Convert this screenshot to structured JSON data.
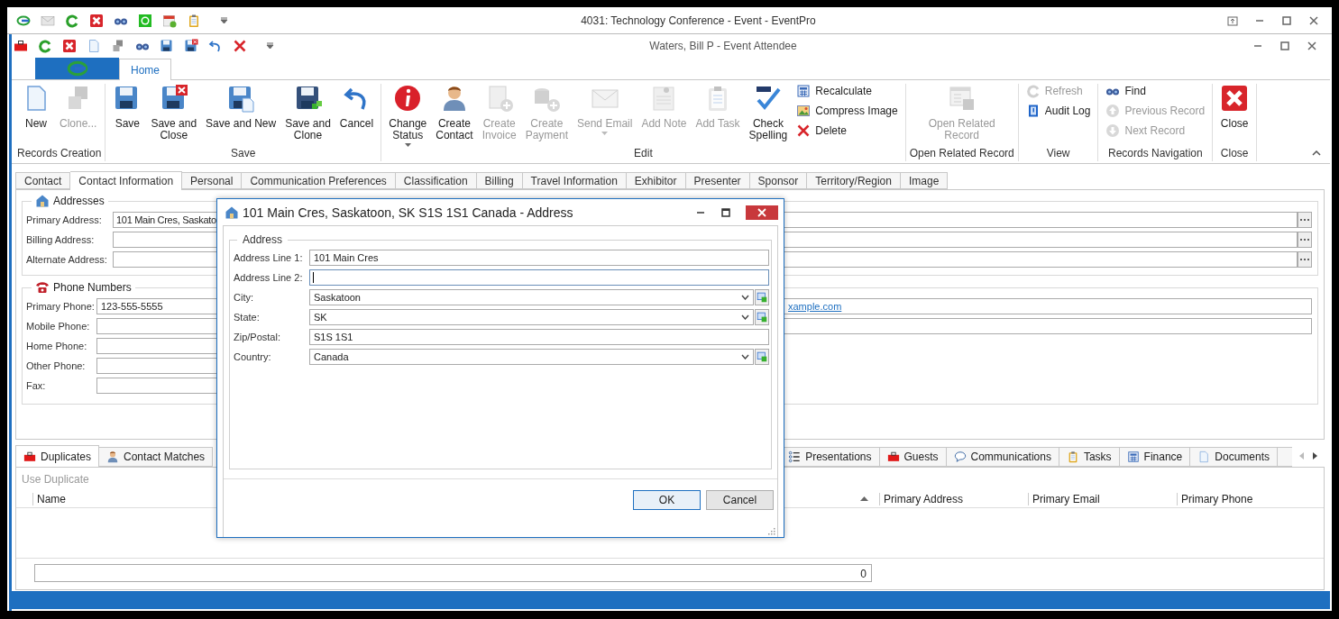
{
  "window": {
    "title": "4031: Technology Conference - Event - EventPro"
  },
  "document_window": {
    "title": "Waters, Bill P - Event Attendee"
  },
  "ribbon": {
    "tabs": [
      {
        "label": "Home",
        "selected": true
      }
    ],
    "groups": [
      {
        "label": "Records Creation",
        "buttons": [
          {
            "label": "New",
            "kind": "large",
            "disabled": false
          },
          {
            "label": "Clone...",
            "kind": "large",
            "disabled": true
          }
        ]
      },
      {
        "label": "Save",
        "buttons": [
          {
            "label": "Save",
            "kind": "large",
            "disabled": false
          },
          {
            "label": "Save and\nClose",
            "kind": "large",
            "disabled": false
          },
          {
            "label": "Save and New",
            "kind": "large",
            "disabled": false
          },
          {
            "label": "Save and\nClone",
            "kind": "large",
            "disabled": false
          },
          {
            "label": "Cancel",
            "kind": "large",
            "disabled": false
          }
        ]
      },
      {
        "label": "Edit",
        "buttons": [
          {
            "label": "Change\nStatus",
            "kind": "large",
            "disabled": false,
            "dropdown": true
          },
          {
            "label": "Create\nContact",
            "kind": "large",
            "disabled": false
          },
          {
            "label": "Create\nInvoice",
            "kind": "large",
            "disabled": true
          },
          {
            "label": "Create\nPayment",
            "kind": "large",
            "disabled": true
          },
          {
            "label": "Send Email",
            "kind": "large",
            "disabled": true,
            "dropdown": true
          },
          {
            "label": "Add Note",
            "kind": "large",
            "disabled": true
          },
          {
            "label": "Add Task",
            "kind": "large",
            "disabled": true
          },
          {
            "label": "Check\nSpelling",
            "kind": "large",
            "disabled": false
          },
          {
            "label": "Recalculate",
            "kind": "small",
            "disabled": false
          },
          {
            "label": "Compress Image",
            "kind": "small",
            "disabled": false
          },
          {
            "label": "Delete",
            "kind": "small",
            "disabled": false
          }
        ]
      },
      {
        "label": "Open Related Record",
        "buttons": [
          {
            "label": "Open Related\nRecord",
            "kind": "large",
            "disabled": true
          }
        ]
      },
      {
        "label": "View",
        "buttons": [
          {
            "label": "Refresh",
            "kind": "small",
            "disabled": true
          },
          {
            "label": "Audit Log",
            "kind": "small",
            "disabled": false
          }
        ]
      },
      {
        "label": "Records Navigation",
        "buttons": [
          {
            "label": "Find",
            "kind": "small",
            "disabled": false
          },
          {
            "label": "Previous Record",
            "kind": "small",
            "disabled": true
          },
          {
            "label": "Next Record",
            "kind": "small",
            "disabled": true
          }
        ]
      },
      {
        "label": "Close",
        "buttons": [
          {
            "label": "Close",
            "kind": "large",
            "disabled": false
          }
        ]
      }
    ]
  },
  "detail_tabs": [
    {
      "label": "Contact",
      "selected": false
    },
    {
      "label": "Contact Information",
      "selected": true
    },
    {
      "label": "Personal",
      "selected": false
    },
    {
      "label": "Communication Preferences",
      "selected": false
    },
    {
      "label": "Classification",
      "selected": false
    },
    {
      "label": "Billing",
      "selected": false
    },
    {
      "label": "Travel Information",
      "selected": false
    },
    {
      "label": "Exhibitor",
      "selected": false
    },
    {
      "label": "Presenter",
      "selected": false
    },
    {
      "label": "Sponsor",
      "selected": false
    },
    {
      "label": "Territory/Region",
      "selected": false
    },
    {
      "label": "Image",
      "selected": false
    }
  ],
  "addresses": {
    "title": "Addresses",
    "fields": [
      {
        "label": "Primary Address:",
        "value": "101 Main Cres, Saskato"
      },
      {
        "label": "Billing Address:"
      },
      {
        "label": "Alternate Address:"
      }
    ]
  },
  "phone_numbers": {
    "title": "Phone Numbers",
    "fields": [
      {
        "label": "Primary Phone:",
        "value": "123-555-5555"
      },
      {
        "label": "Mobile Phone:"
      },
      {
        "label": "Home Phone:"
      },
      {
        "label": "Other Phone:"
      },
      {
        "label": "Fax:"
      }
    ],
    "right_fields": [
      {
        "kind": "link",
        "value": "xample.com"
      },
      {
        "kind": "empty"
      }
    ]
  },
  "bottom_tabs_left": [
    {
      "label": "Duplicates",
      "selected": true
    },
    {
      "label": "Contact Matches",
      "selected": false
    }
  ],
  "bottom_tabs_right": [
    {
      "label": "Presentations",
      "selected": false
    },
    {
      "label": "Guests",
      "selected": false
    },
    {
      "label": "Communications",
      "selected": false
    },
    {
      "label": "Tasks",
      "selected": false
    },
    {
      "label": "Finance",
      "selected": false
    },
    {
      "label": "Documents",
      "selected": false
    }
  ],
  "duplicates": {
    "action": "Use Duplicate",
    "action_disabled": true,
    "columns": [
      {
        "label": "Name"
      },
      {
        "label": "Primary Address"
      },
      {
        "label": "Primary Email"
      },
      {
        "label": "Primary Phone"
      }
    ],
    "footer_value": "0"
  },
  "dialog": {
    "title": "101 Main Cres, Saskatoon, SK S1S 1S1 Canada - Address",
    "group": "Address",
    "fields": [
      {
        "label": "Address Line 1:",
        "kind": "text",
        "value": "101 Main Cres",
        "focused": false
      },
      {
        "label": "Address Line 2:",
        "kind": "text",
        "focused": true
      },
      {
        "label": "City:",
        "kind": "combo",
        "value": "Saskatoon",
        "focused": false
      },
      {
        "label": "State:",
        "kind": "combo",
        "value": "SK",
        "focused": false
      },
      {
        "label": "Zip/Postal:",
        "kind": "text",
        "value": "S1S 1S1",
        "focused": false
      },
      {
        "label": "Country:",
        "kind": "combo",
        "value": "Canada",
        "focused": false
      }
    ],
    "buttons": [
      {
        "label": "OK",
        "default": true
      },
      {
        "label": "Cancel",
        "default": false
      }
    ]
  }
}
